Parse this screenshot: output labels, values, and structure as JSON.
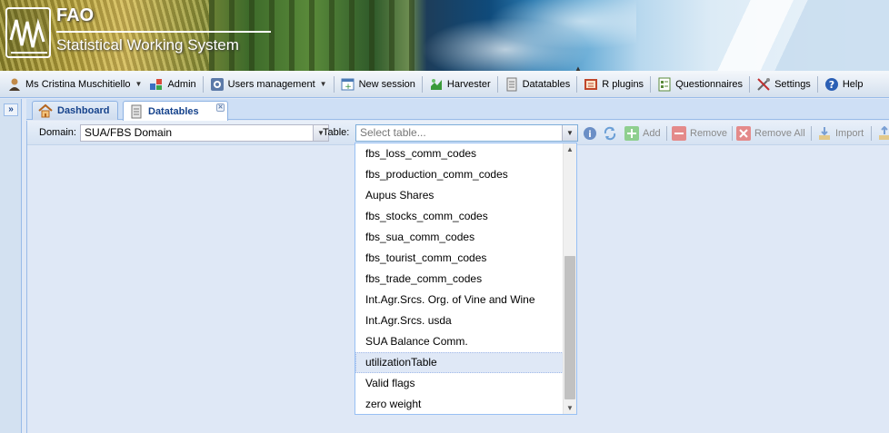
{
  "banner": {
    "logo_text": "FAO",
    "subtitle": "Statistical Working System"
  },
  "menubar": {
    "user": "Ms Cristina Muschitiello",
    "items": [
      {
        "label": "Admin",
        "icon": "admin-icon"
      },
      {
        "label": "Users management",
        "icon": "users-icon"
      },
      {
        "label": "New session",
        "icon": "new-session-icon"
      },
      {
        "label": "Harvester",
        "icon": "harvester-icon"
      },
      {
        "label": "Datatables",
        "icon": "datatables-icon"
      },
      {
        "label": "R plugins",
        "icon": "r-plugins-icon"
      },
      {
        "label": "Questionnaires",
        "icon": "questionnaires-icon"
      },
      {
        "label": "Settings",
        "icon": "settings-icon"
      },
      {
        "label": "Help",
        "icon": "help-icon"
      }
    ]
  },
  "left_panel": {
    "expand_label": "»"
  },
  "tabs": [
    {
      "label": "Dashboard",
      "icon": "home-icon",
      "active": false
    },
    {
      "label": "Datatables",
      "icon": "datatables-icon",
      "active": true,
      "closable": true
    }
  ],
  "toolbar": {
    "domain_label": "Domain:",
    "domain_value": "SUA/FBS Domain",
    "table_label": "Table:",
    "table_placeholder": "Select table...",
    "buttons": [
      {
        "label": "Add",
        "icon": "add-icon",
        "enabled": false
      },
      {
        "label": "Remove",
        "icon": "remove-icon",
        "enabled": false
      },
      {
        "label": "Remove All",
        "icon": "remove-all-icon",
        "enabled": false
      },
      {
        "label": "Import",
        "icon": "import-icon",
        "enabled": false
      }
    ]
  },
  "dropdown": {
    "options": [
      "fbs_loss_comm_codes",
      "fbs_production_comm_codes",
      "Aupus Shares",
      "fbs_stocks_comm_codes",
      "fbs_sua_comm_codes",
      "fbs_tourist_comm_codes",
      "fbs_trade_comm_codes",
      "Int.Agr.Srcs. Org. of Vine and Wine",
      "Int.Agr.Srcs. usda",
      "SUA Balance Comm.",
      "utilizationTable",
      "Valid flags",
      "zero weight"
    ],
    "highlighted": "utilizationTable"
  },
  "colors": {
    "accent": "#15428b",
    "panel_bg": "#dfe8f6",
    "border": "#99bbe8",
    "highlight": "#dfe8f6"
  }
}
